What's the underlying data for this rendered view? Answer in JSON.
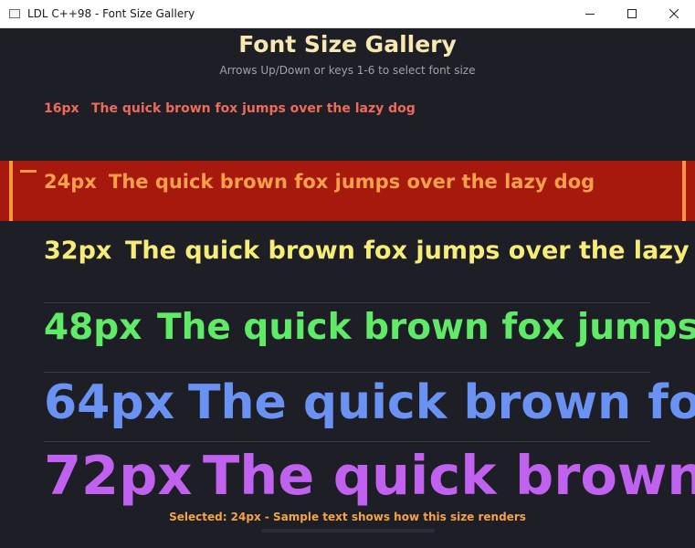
{
  "window": {
    "title": "LDL C++98 - Font Size Gallery",
    "controls": {
      "minimize": "minimize-icon",
      "maximize": "maximize-icon",
      "close": "close-icon"
    }
  },
  "header": {
    "title": "Font Size Gallery",
    "subtitle": "Arrows Up/Down or keys 1-6 to select font size"
  },
  "rows": [
    {
      "size_label": "16px",
      "sample": "The quick brown fox jumps over the lazy dog",
      "color": "#ee6a5a",
      "selected": false
    },
    {
      "size_label": "24px",
      "sample": "The quick brown fox jumps over the lazy dog",
      "color": "#f9a04b",
      "selected": true
    },
    {
      "size_label": "32px",
      "sample": "The quick brown fox jumps over the lazy dog",
      "color": "#f6ed78",
      "selected": false
    },
    {
      "size_label": "48px",
      "sample": "The quick brown fox jumps over the lazy dog",
      "color": "#5fea67",
      "selected": false
    },
    {
      "size_label": "64px",
      "sample": "The quick brown fox jumps over the lazy dog",
      "color": "#6a92f2",
      "selected": false
    },
    {
      "size_label": "72px",
      "sample": "The quick brown fox jumps over the lazy dog",
      "color": "#c161f0",
      "selected": false
    }
  ],
  "colors": {
    "background": "#1e1f26",
    "selection_fill": "#a8190d",
    "selection_accent": "#f7963c",
    "title": "#f6e8b0"
  },
  "footer": {
    "status": "Selected: 24px - Sample text shows how this size renders"
  }
}
